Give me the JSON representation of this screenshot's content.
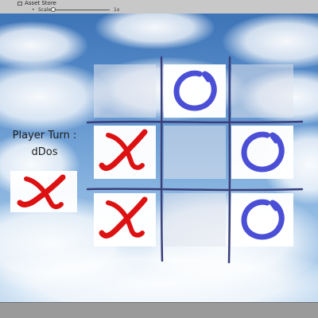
{
  "editor": {
    "tab_title": "Asset Store",
    "scale_label": "Scale",
    "scale_value": "1x"
  },
  "game": {
    "turn_label": "Player Turn :",
    "player_name": "dDos",
    "current_mark": "X",
    "board": [
      [
        "",
        "O",
        ""
      ],
      [
        "X",
        "",
        "O"
      ],
      [
        "X",
        "",
        "O"
      ]
    ],
    "colors": {
      "x_mark": "#dd1111",
      "o_mark": "#4a4fd6",
      "grid_line": "#3a3e7a"
    },
    "icons": {
      "x": "x-mark-icon",
      "o": "o-mark-icon"
    }
  }
}
